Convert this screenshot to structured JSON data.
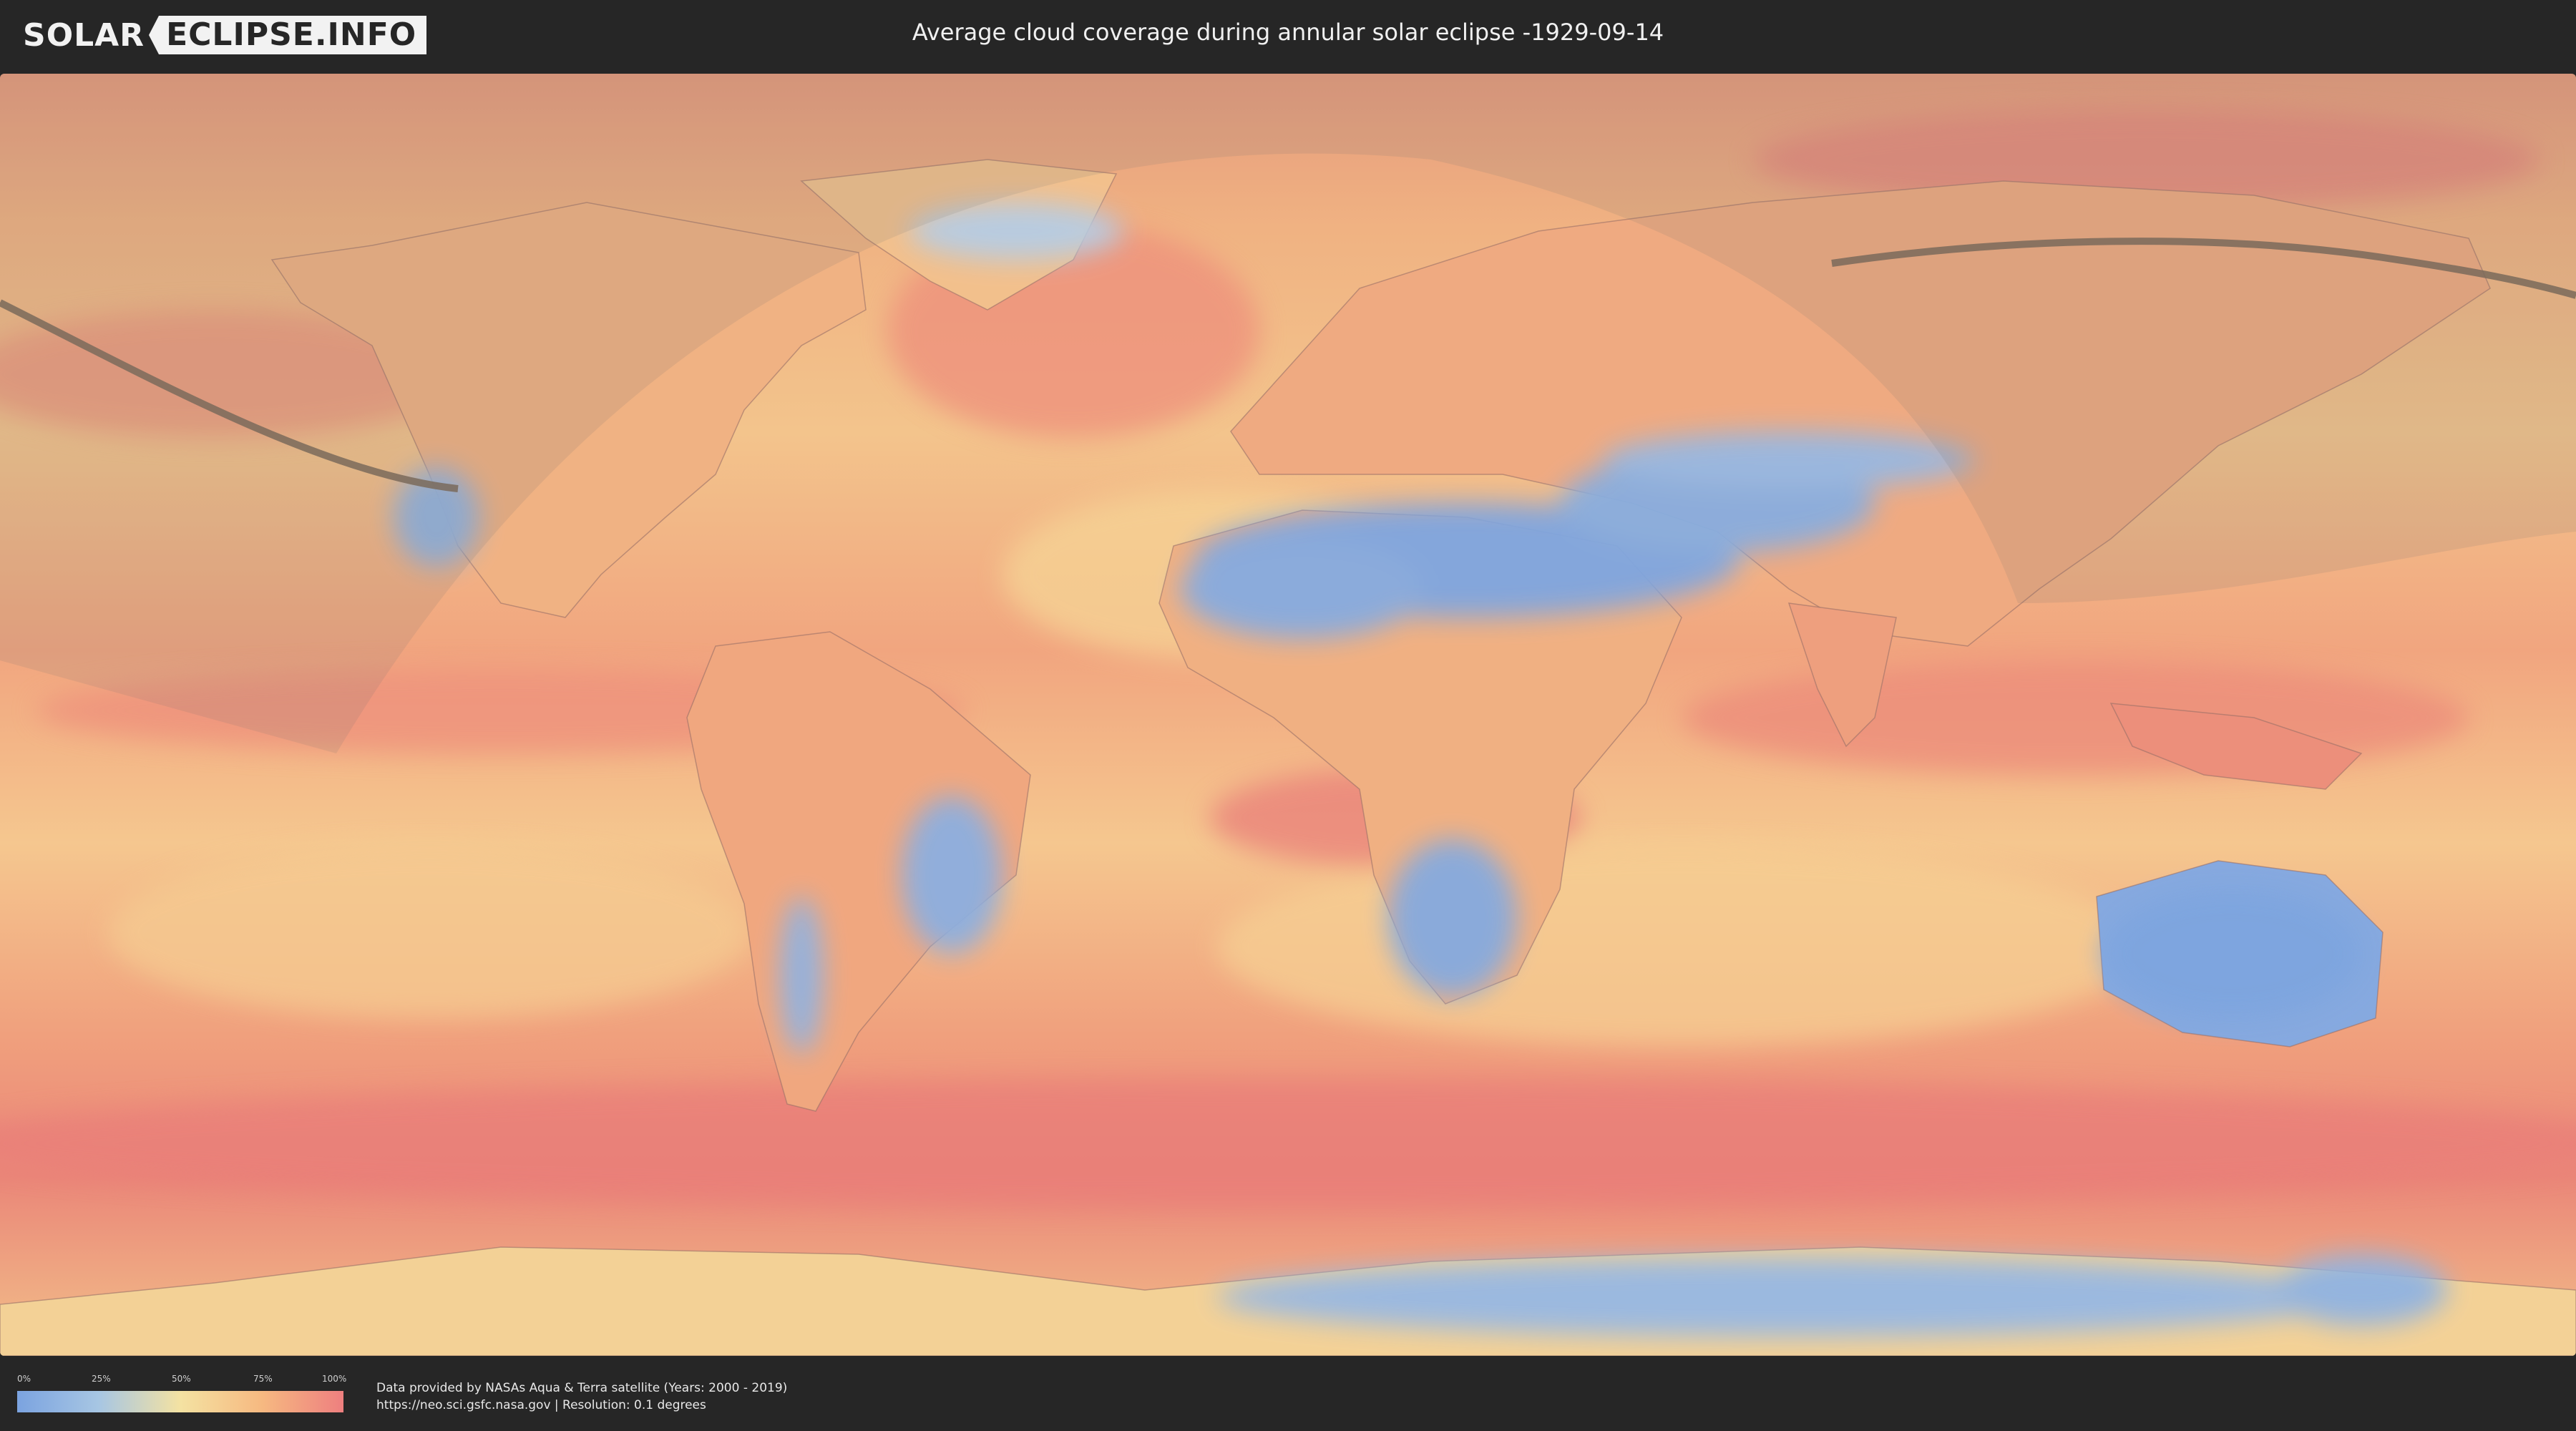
{
  "header": {
    "logo_left": "SOLAR",
    "logo_right": "ECLIPSE.INFO",
    "title": "Average cloud coverage during annular solar eclipse -1929-09-14"
  },
  "map": {
    "description_icon": "world-map-cloud-coverage",
    "colors": {
      "low": "#7ba3e0",
      "mid_low": "#a7c6e3",
      "mid": "#f4e2a2",
      "mid_high": "#f6b981",
      "high": "#ee7f7f",
      "ocean_base": "#f1b07e"
    }
  },
  "legend": {
    "ticks": [
      "0%",
      "25%",
      "50%",
      "75%",
      "100%"
    ]
  },
  "credits": {
    "line1": "Data provided by NASAs Aqua & Terra satellite (Years: 2000 - 2019)",
    "line2": "https://neo.sci.gsfc.nasa.gov | Resolution: 0.1 degrees"
  }
}
